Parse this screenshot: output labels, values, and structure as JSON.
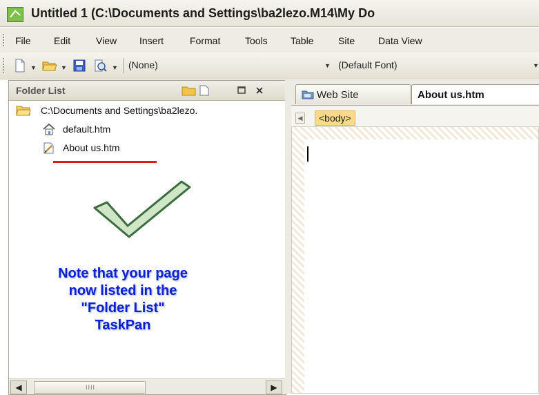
{
  "window": {
    "title": "Untitled 1 (C:\\Documents and Settings\\ba2lezo.M14\\My Do"
  },
  "menu": [
    "File",
    "Edit",
    "View",
    "Insert",
    "Format",
    "Tools",
    "Table",
    "Site",
    "Data View"
  ],
  "toolbar": {
    "style_value": "(None)",
    "font_value": "(Default Font)"
  },
  "folder_panel": {
    "title": "Folder List",
    "root": "C:\\Documents and Settings\\ba2lezo.",
    "files": [
      "default.htm",
      "About us.htm"
    ],
    "note_lines": [
      "Note that your page",
      "now listed in the",
      "\"Folder List\"",
      "TaskPan"
    ]
  },
  "editor": {
    "tabs": [
      "Web Site",
      "About us.htm"
    ],
    "active_tab": "About us.htm",
    "tag": "<body>"
  },
  "colors": {
    "note": "#0c21d0",
    "underline": "#e01d1d",
    "tag_highlight": "#fcd98a",
    "check": "#cfe7c6"
  }
}
